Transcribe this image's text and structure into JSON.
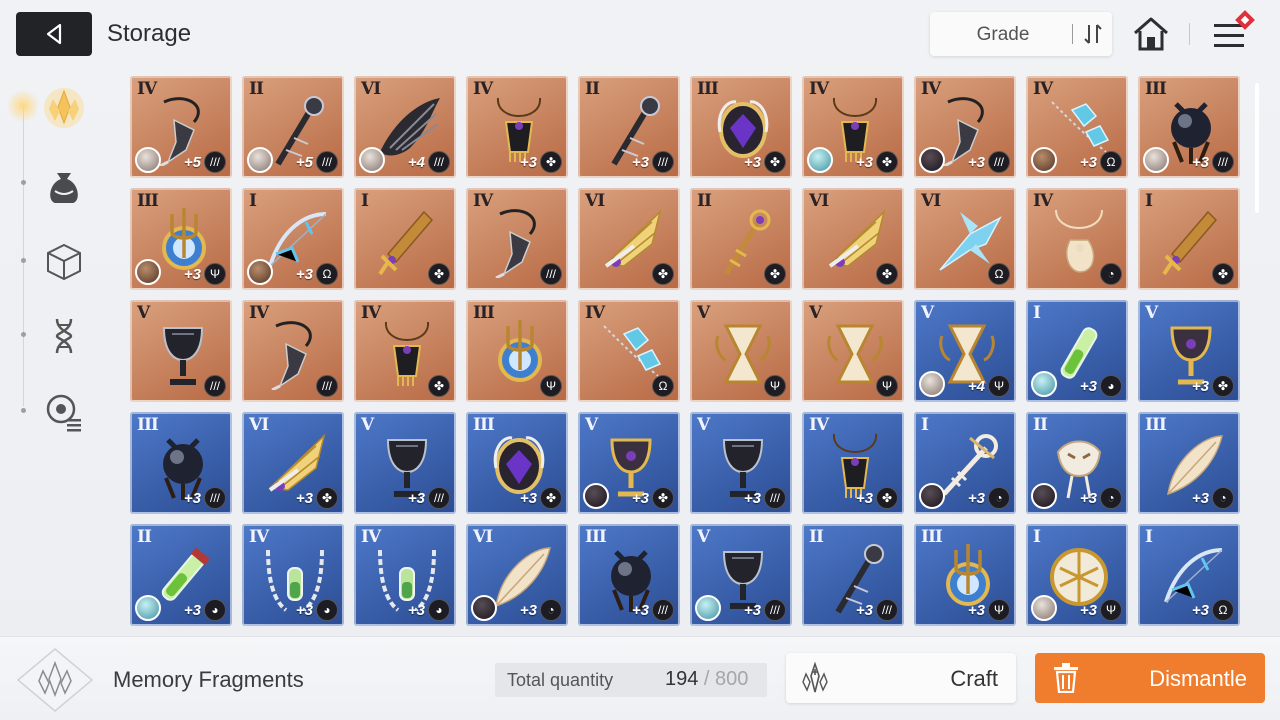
{
  "header": {
    "title": "Storage",
    "grade_label": "Grade"
  },
  "sidebar": {
    "items": [
      {
        "icon": "memory-fragment-icon",
        "active": true
      },
      {
        "icon": "pouch-icon",
        "active": false
      },
      {
        "icon": "cube-icon",
        "active": false
      },
      {
        "icon": "dna-icon",
        "active": false
      },
      {
        "icon": "badge-list-icon",
        "active": false
      }
    ]
  },
  "grid": {
    "items": [
      {
        "tier": "IV",
        "level": "+5",
        "set": "claw",
        "bg": "orange",
        "avatar": "light",
        "art": "whip"
      },
      {
        "tier": "II",
        "level": "+5",
        "set": "claw",
        "bg": "orange",
        "avatar": "light",
        "art": "staff"
      },
      {
        "tier": "VI",
        "level": "+4",
        "set": "claw",
        "bg": "orange",
        "avatar": "light",
        "art": "wing-dark"
      },
      {
        "tier": "IV",
        "level": "+3",
        "set": "cluster",
        "bg": "orange",
        "avatar": "",
        "art": "pendant"
      },
      {
        "tier": "II",
        "level": "+3",
        "set": "claw",
        "bg": "orange",
        "avatar": "",
        "art": "staff"
      },
      {
        "tier": "III",
        "level": "+3",
        "set": "cluster",
        "bg": "orange",
        "avatar": "",
        "art": "orb-gem"
      },
      {
        "tier": "IV",
        "level": "+3",
        "set": "cluster",
        "bg": "orange",
        "avatar": "teal",
        "art": "pendant"
      },
      {
        "tier": "IV",
        "level": "+3",
        "set": "claw",
        "bg": "orange",
        "avatar": "dark",
        "art": "whip"
      },
      {
        "tier": "IV",
        "level": "+3",
        "set": "scale",
        "bg": "orange",
        "avatar": "brown",
        "art": "chain-blue"
      },
      {
        "tier": "III",
        "level": "+3",
        "set": "claw",
        "bg": "orange",
        "avatar": "light",
        "art": "orb-dark"
      },
      {
        "tier": "III",
        "level": "+3",
        "set": "trident",
        "bg": "orange",
        "avatar": "brown",
        "art": "trident-orb"
      },
      {
        "tier": "I",
        "level": "+3",
        "set": "scale",
        "bg": "orange",
        "avatar": "brown",
        "art": "bow"
      },
      {
        "tier": "I",
        "level": "",
        "set": "cluster",
        "bg": "orange",
        "avatar": "",
        "art": "sword"
      },
      {
        "tier": "IV",
        "level": "",
        "set": "claw",
        "bg": "orange",
        "avatar": "",
        "art": "whip"
      },
      {
        "tier": "VI",
        "level": "",
        "set": "cluster",
        "bg": "orange",
        "avatar": "",
        "art": "wing-gold"
      },
      {
        "tier": "II",
        "level": "",
        "set": "cluster",
        "bg": "orange",
        "avatar": "",
        "art": "scepter"
      },
      {
        "tier": "VI",
        "level": "",
        "set": "cluster",
        "bg": "orange",
        "avatar": "",
        "art": "wing-gold"
      },
      {
        "tier": "VI",
        "level": "",
        "set": "scale",
        "bg": "orange",
        "avatar": "",
        "art": "crystal-wing"
      },
      {
        "tier": "IV",
        "level": "",
        "set": "swirl",
        "bg": "orange",
        "avatar": "",
        "art": "cream-pendant"
      },
      {
        "tier": "I",
        "level": "",
        "set": "cluster",
        "bg": "orange",
        "avatar": "",
        "art": "sword"
      },
      {
        "tier": "V",
        "level": "",
        "set": "claw",
        "bg": "orange",
        "avatar": "",
        "art": "goblet-dark"
      },
      {
        "tier": "IV",
        "level": "",
        "set": "claw",
        "bg": "orange",
        "avatar": "",
        "art": "whip"
      },
      {
        "tier": "IV",
        "level": "",
        "set": "cluster",
        "bg": "orange",
        "avatar": "",
        "art": "pendant"
      },
      {
        "tier": "III",
        "level": "",
        "set": "trident",
        "bg": "orange",
        "avatar": "",
        "art": "trident-orb"
      },
      {
        "tier": "IV",
        "level": "",
        "set": "scale",
        "bg": "orange",
        "avatar": "",
        "art": "chain-blue"
      },
      {
        "tier": "V",
        "level": "",
        "set": "trident",
        "bg": "orange",
        "avatar": "",
        "art": "hourglass"
      },
      {
        "tier": "V",
        "level": "",
        "set": "trident",
        "bg": "orange",
        "avatar": "",
        "art": "hourglass"
      },
      {
        "tier": "V",
        "level": "+4",
        "set": "trident",
        "bg": "blue",
        "avatar": "light",
        "art": "hourglass"
      },
      {
        "tier": "I",
        "level": "+3",
        "set": "drop",
        "bg": "blue",
        "avatar": "teal",
        "art": "vial"
      },
      {
        "tier": "V",
        "level": "+3",
        "set": "cluster",
        "bg": "blue",
        "avatar": "",
        "art": "goblet-gold"
      },
      {
        "tier": "III",
        "level": "+3",
        "set": "claw",
        "bg": "blue",
        "avatar": "",
        "art": "orb-dark"
      },
      {
        "tier": "VI",
        "level": "+3",
        "set": "cluster",
        "bg": "blue",
        "avatar": "",
        "art": "wing-gold"
      },
      {
        "tier": "V",
        "level": "+3",
        "set": "claw",
        "bg": "blue",
        "avatar": "",
        "art": "goblet-dark"
      },
      {
        "tier": "III",
        "level": "+3",
        "set": "cluster",
        "bg": "blue",
        "avatar": "",
        "art": "orb-gem"
      },
      {
        "tier": "V",
        "level": "+3",
        "set": "cluster",
        "bg": "blue",
        "avatar": "dark",
        "art": "goblet-gold"
      },
      {
        "tier": "V",
        "level": "+3",
        "set": "claw",
        "bg": "blue",
        "avatar": "",
        "art": "goblet-dark"
      },
      {
        "tier": "IV",
        "level": "+3",
        "set": "cluster",
        "bg": "blue",
        "avatar": "",
        "art": "pendant"
      },
      {
        "tier": "I",
        "level": "+3",
        "set": "swirl",
        "bg": "blue",
        "avatar": "dark",
        "art": "key-white"
      },
      {
        "tier": "II",
        "level": "+3",
        "set": "swirl",
        "bg": "blue",
        "avatar": "dark",
        "art": "mask"
      },
      {
        "tier": "III",
        "level": "+3",
        "set": "swirl",
        "bg": "blue",
        "avatar": "",
        "art": "feather"
      },
      {
        "tier": "II",
        "level": "+3",
        "set": "drop",
        "bg": "blue",
        "avatar": "teal",
        "art": "vial-red"
      },
      {
        "tier": "IV",
        "level": "+3",
        "set": "drop",
        "bg": "blue",
        "avatar": "",
        "art": "chain-vial"
      },
      {
        "tier": "IV",
        "level": "+3",
        "set": "drop",
        "bg": "blue",
        "avatar": "",
        "art": "chain-vial"
      },
      {
        "tier": "VI",
        "level": "+3",
        "set": "swirl",
        "bg": "blue",
        "avatar": "dark",
        "art": "feather"
      },
      {
        "tier": "III",
        "level": "+3",
        "set": "claw",
        "bg": "blue",
        "avatar": "",
        "art": "orb-dark"
      },
      {
        "tier": "V",
        "level": "+3",
        "set": "claw",
        "bg": "blue",
        "avatar": "teal",
        "art": "goblet-dark"
      },
      {
        "tier": "II",
        "level": "+3",
        "set": "claw",
        "bg": "blue",
        "avatar": "",
        "art": "staff"
      },
      {
        "tier": "III",
        "level": "+3",
        "set": "trident",
        "bg": "blue",
        "avatar": "",
        "art": "trident-orb"
      },
      {
        "tier": "I",
        "level": "+3",
        "set": "trident",
        "bg": "blue",
        "avatar": "light",
        "art": "shield-gold"
      },
      {
        "tier": "I",
        "level": "+3",
        "set": "scale",
        "bg": "blue",
        "avatar": "",
        "art": "bow"
      }
    ]
  },
  "footer": {
    "title": "Memory Fragments",
    "qty_label": "Total quantity",
    "qty_current": "194",
    "qty_sep": " / ",
    "qty_max": "800",
    "craft_label": "Craft",
    "dismantle_label": "Dismantle"
  },
  "colors": {
    "accent": "#f07d2d",
    "card_orange": "#c67e57",
    "card_blue": "#3a60ad"
  }
}
